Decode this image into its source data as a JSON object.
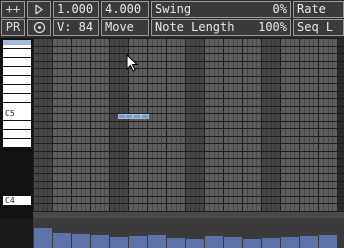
{
  "toolbar": {
    "add_label": "++",
    "play_icon": "play-icon",
    "length_value": "1.000",
    "grid_value": "4.000",
    "swing_label": "Swing",
    "swing_value": "0%",
    "rate_label": "Rate",
    "pr_label": "PR",
    "help_icon": "help-icon",
    "velocity_label": "V: 84",
    "move_label": "Move",
    "note_length_label": "Note Length",
    "note_length_value": "100%",
    "seq_label": "Seq L"
  },
  "piano": {
    "octave_labels": [
      "C5",
      "C4"
    ]
  },
  "notes": [
    {
      "pitch": "C5",
      "step": 11
    },
    {
      "pitch": "C5",
      "step": 12
    },
    {
      "pitch": "C5",
      "step": 13
    },
    {
      "pitch": "C5",
      "step": 14
    }
  ],
  "colors": {
    "background": "#2b2b2b",
    "cell": "#5e5e5e",
    "beat_column": "#464646",
    "note": "#8098c8",
    "velocity_bar": "#5c72a8"
  }
}
